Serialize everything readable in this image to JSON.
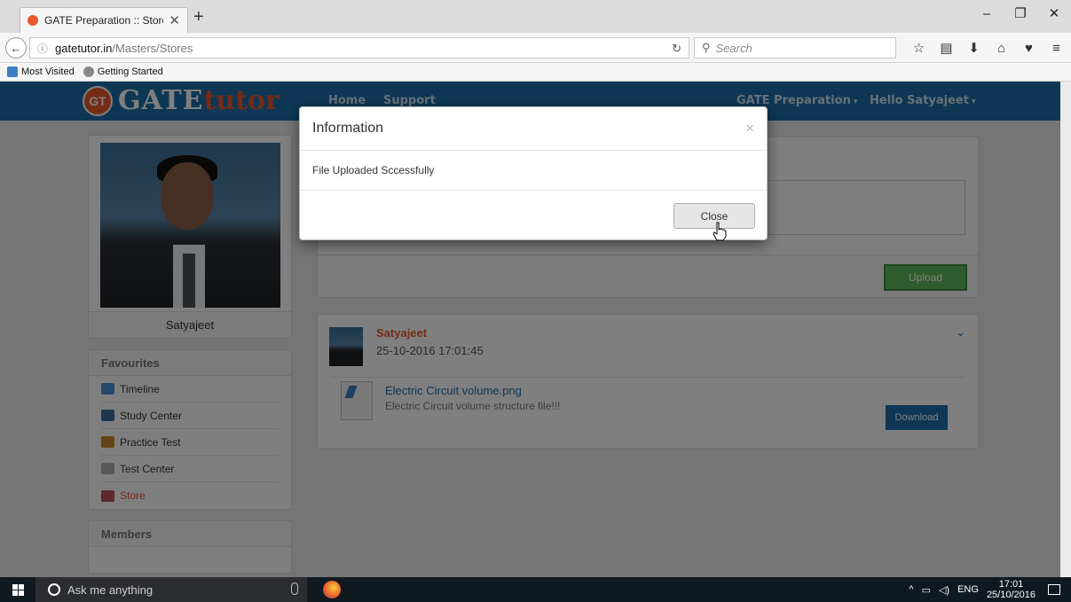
{
  "browser": {
    "tab_title": "GATE Preparation :: Store",
    "url_domain": "gatetutor.in",
    "url_path": "/Masters/Stores",
    "search_placeholder": "Search",
    "bookmarks": [
      "Most Visited",
      "Getting Started"
    ]
  },
  "site": {
    "logo_gt": "GT",
    "logo_gate": "GATE",
    "logo_tutor": "tutor",
    "nav_home": "Home",
    "nav_support": "Support",
    "nav_gate_prep": "GATE Preparation",
    "nav_user": "Hello Satyajeet"
  },
  "sidebar": {
    "profile_name": "Satyajeet",
    "favourites_title": "Favourites",
    "items": [
      {
        "label": "Timeline",
        "icon": "timeline-icon"
      },
      {
        "label": "Study Center",
        "icon": "study-center-icon"
      },
      {
        "label": "Practice Test",
        "icon": "practice-test-icon"
      },
      {
        "label": "Test Center",
        "icon": "test-center-icon"
      },
      {
        "label": "Store",
        "icon": "store-icon",
        "active": true
      }
    ],
    "members_title": "Members"
  },
  "upload": {
    "button_label": "Upload"
  },
  "post": {
    "author": "Satyajeet",
    "timestamp": "25-10-2016 17:01:45",
    "file_name": "Electric Circuit volume.png",
    "file_description": "Electric Circuit volume structure file!!!",
    "download_label": "Download"
  },
  "modal": {
    "title": "Information",
    "close_x": "×",
    "message": "File Uploaded Sccessfully",
    "close_button": "Close"
  },
  "taskbar": {
    "cortana_placeholder": "Ask me anything",
    "language": "ENG",
    "time": "17:01",
    "date": "25/10/2016"
  },
  "colors": {
    "header_blue": "#1a6fa8",
    "brand_orange": "#e8582b",
    "upload_green": "#5cb85c",
    "download_blue": "#1f6eaa"
  }
}
